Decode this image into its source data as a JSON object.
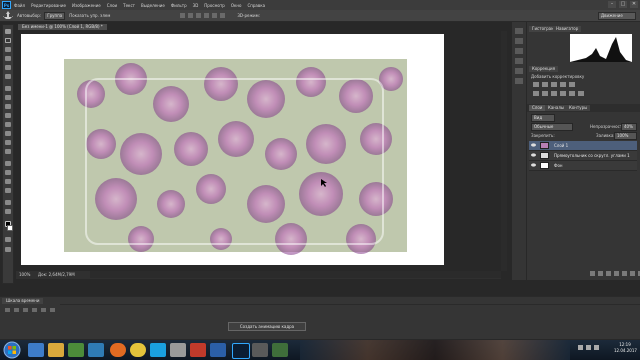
{
  "menu": {
    "logo": "Ps",
    "items": [
      "Файл",
      "Редактирование",
      "Изображение",
      "Слои",
      "Текст",
      "Выделение",
      "Фильтр",
      "3D",
      "Просмотр",
      "Окно",
      "Справка"
    ]
  },
  "window_controls": {
    "min": "–",
    "max": "□",
    "close": "✕"
  },
  "options": {
    "autoselect_label": "Автовыбор:",
    "autoselect_value": "Группа",
    "transform_label": "Показать упр. элем",
    "mode_label": "3D-режим:"
  },
  "workspace": "Движение",
  "document": {
    "tab_title": "Без имени-1 @ 100% (Слой 1, RGB/8) *",
    "zoom": "100%",
    "doc_info": "Док: 2,64М/2,79М"
  },
  "panels": {
    "histogram_tab": "Гистограмма",
    "navigator_tab": "Навигатор",
    "adjustments_tab": "Коррекция",
    "adjustments_title": "Добавить корректировку",
    "layers_tab": "Слои",
    "channels_tab": "Каналы",
    "paths_tab": "Контуры",
    "kind_value": "Вид",
    "blend_mode": "Обычные",
    "opacity_label": "Непрозрачность:",
    "opacity_value": "40%",
    "lock_label": "Закрепить:",
    "fill_label": "Заливка:",
    "fill_value": "100%",
    "layers": [
      {
        "name": "Слой 1",
        "active": true
      },
      {
        "name": "Прямоугольник со скругл. углами 1",
        "active": false
      },
      {
        "name": "Фон",
        "active": false
      }
    ]
  },
  "timeline": {
    "tab": "Шкала времени",
    "create_button": "Создать анимацию кадра"
  },
  "taskbar": {
    "time": "12:19",
    "date": "12.04.2017"
  },
  "colors": {
    "photoshop_accent": "#31a8ff",
    "selection": "#4d5f7b",
    "canvas": "#ffffff",
    "flower": "#c35fc0"
  },
  "icons": [
    "move-tool-icon",
    "marquee-tool-icon",
    "lasso-tool-icon",
    "quick-select-icon",
    "crop-icon",
    "eyedropper-icon",
    "healing-brush-icon",
    "brush-icon",
    "clone-stamp-icon",
    "history-brush-icon",
    "eraser-icon",
    "gradient-icon",
    "blur-icon",
    "dodge-icon",
    "pen-icon",
    "type-icon",
    "path-select-icon",
    "shape-icon",
    "hand-icon",
    "zoom-icon",
    "foreground-color",
    "background-color",
    "quick-mask-icon",
    "screen-mode-icon"
  ]
}
